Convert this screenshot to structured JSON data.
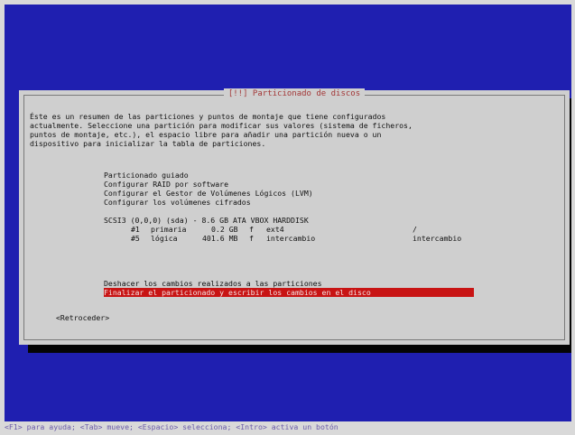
{
  "dialog": {
    "title": "[!!] Particionado de discos",
    "description": "Éste es un resumen de las particiones y puntos de montaje que tiene configurados\nactualmente. Seleccione una partición para modificar sus valores (sistema de ficheros,\npuntos de montaje, etc.), el espacio libre para añadir una partición nueva o un\ndispositivo para inicializar la tabla de particiones.",
    "menu": {
      "options": [
        "Particionado guiado",
        "Configurar RAID por software",
        "Configurar el Gestor de Volúmenes Lógicos (LVM)",
        "Configurar los volúmenes cifrados"
      ],
      "disk": "SCSI3 (0,0,0) (sda) - 8.6 GB ATA VBOX HARDDISK",
      "partitions": [
        {
          "number": "#1",
          "type": "primaria",
          "size": "0.2 GB",
          "flag": "f",
          "format": "ext4",
          "mount": "/"
        },
        {
          "number": "#5",
          "type": "lógica",
          "size": "401.6 MB",
          "flag": "f",
          "format": "intercambio",
          "mount": "intercambio"
        }
      ],
      "undo": "Deshacer los cambios realizados a las particiones",
      "finish": "Finalizar el particionado y escribir los cambios en el disco"
    },
    "back": "<Retroceder>"
  },
  "footer": {
    "help": "<F1> para ayuda; <Tab> mueve; <Espacio> selecciona; <Intro> activa un botón"
  },
  "colors": {
    "background": "#1f1fb0",
    "dialog": "#cfcfcf",
    "title": "#a33838",
    "selected": "#c81414",
    "footer_text": "#6a5ba8"
  }
}
